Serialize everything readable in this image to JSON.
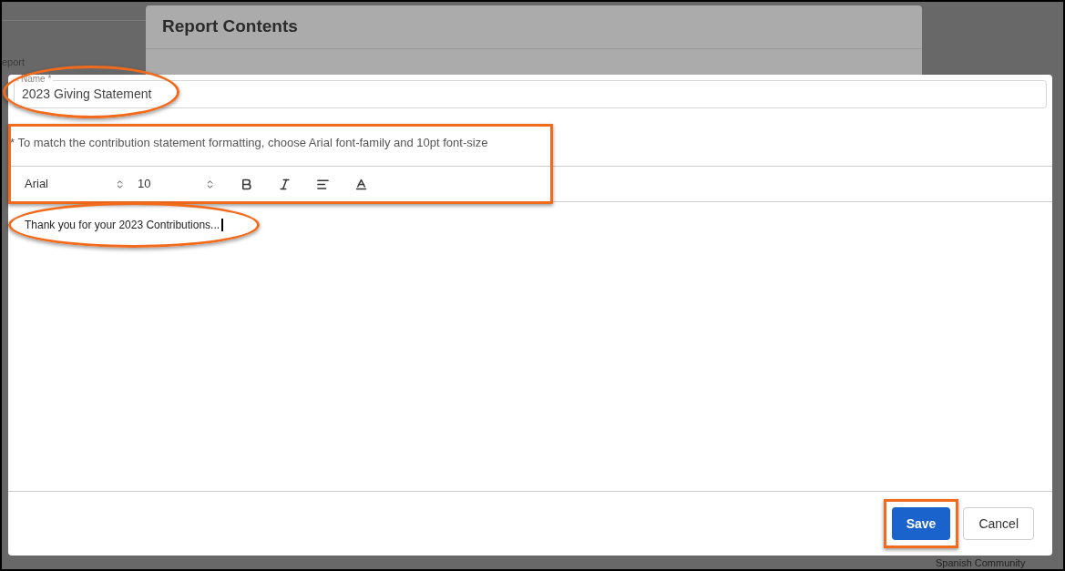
{
  "background": {
    "field_label": "eport",
    "footer_text": "Spanish Community"
  },
  "back_dialog": {
    "title": "Report Contents"
  },
  "dialog": {
    "name_field": {
      "label": "Name *",
      "value": "2023 Giving Statement",
      "circled": true
    },
    "format_section": {
      "hint": "* To match the contribution statement formatting, choose Arial font-family and 10pt font-size",
      "boxed": true,
      "toolbar": {
        "font_family": "Arial",
        "font_size": "10",
        "tools": [
          {
            "kind": "bold"
          },
          {
            "kind": "italic"
          },
          {
            "kind": "align"
          },
          {
            "kind": "color"
          }
        ]
      }
    },
    "body": {
      "text": "Thank you for your 2023 Contributions...",
      "circled": true
    },
    "buttons": [
      {
        "label": "Save",
        "kind": "primary",
        "boxed": true
      },
      {
        "label": "Cancel",
        "kind": "secondary",
        "boxed": false
      }
    ]
  }
}
